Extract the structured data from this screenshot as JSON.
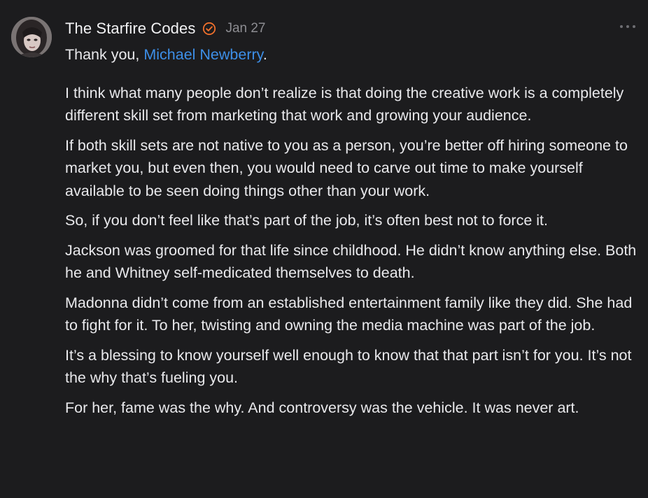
{
  "comment": {
    "author": "The Starfire Codes",
    "date": "Jan 27",
    "verified_badge_icon": "verified-check-icon",
    "verified_color": "#f0702c",
    "more_icon": "more-horizontal-icon",
    "greeting_prefix": "Thank you, ",
    "mention": "Michael Newberry",
    "mention_color": "#3d8fe8",
    "greeting_suffix": ".",
    "paragraphs": [
      "I think what many people don’t realize is that doing the creative work is a completely different skill set from marketing that work and growing your audience.",
      "If both skill sets are not native to you as a person, you’re better off hiring someone to market you, but even then, you would need to carve out time to make yourself available to be seen doing things other than your work.",
      "So, if you don’t feel like that’s part of the job, it’s often best not to force it.",
      "Jackson was groomed for that life since childhood. He didn’t know anything else. Both he and Whitney self-medicated themselves to death.",
      "Madonna didn’t come from an established entertainment family like they did. She had to fight for it. To her, twisting and owning the media machine was part of the job.",
      "It’s a blessing to know yourself well enough to know that that part isn’t for you. It’s not the why that’s fueling you.",
      "For her, fame was the why. And controversy was the vehicle. It was never art."
    ]
  }
}
